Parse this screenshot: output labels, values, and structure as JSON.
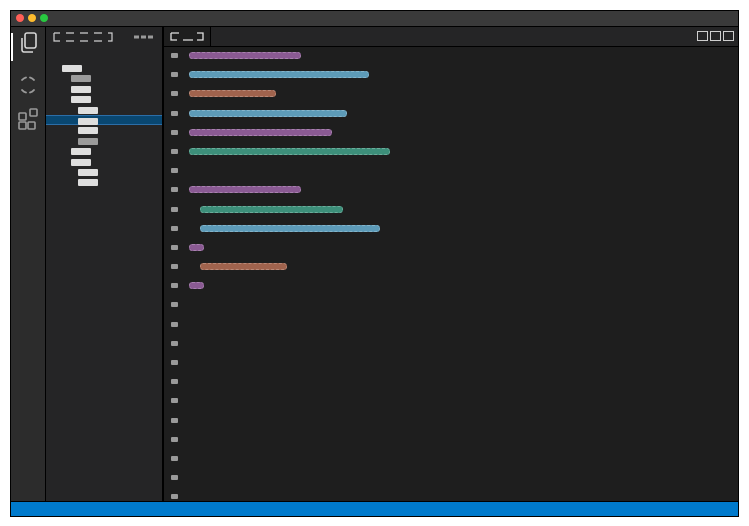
{
  "window": {
    "traffic_lights": [
      {
        "name": "close",
        "color": "#ff5f57"
      },
      {
        "name": "minimize",
        "color": "#febc2e"
      },
      {
        "name": "maximize",
        "color": "#28c840"
      }
    ]
  },
  "activity_bar": {
    "items": [
      {
        "name": "explorer-icon",
        "active": true
      },
      {
        "name": "source-control-icon",
        "active": false
      },
      {
        "name": "extensions-icon",
        "active": false
      }
    ]
  },
  "sidebar": {
    "header_title": "",
    "header_actions": "",
    "tree": [
      {
        "indent": 0,
        "width": 20,
        "dim": false,
        "selected": false
      },
      {
        "indent": 1,
        "width": 20,
        "dim": true,
        "selected": false
      },
      {
        "indent": 1,
        "width": 20,
        "dim": false,
        "selected": false
      },
      {
        "indent": 1,
        "width": 20,
        "dim": false,
        "selected": false
      },
      {
        "indent": 2,
        "width": 20,
        "dim": false,
        "selected": false
      },
      {
        "indent": 2,
        "width": 20,
        "dim": false,
        "selected": true
      },
      {
        "indent": 2,
        "width": 20,
        "dim": false,
        "selected": false
      },
      {
        "indent": 2,
        "width": 20,
        "dim": true,
        "selected": false
      },
      {
        "indent": 1,
        "width": 20,
        "dim": false,
        "selected": false
      },
      {
        "indent": 1,
        "width": 20,
        "dim": false,
        "selected": false
      },
      {
        "indent": 2,
        "width": 20,
        "dim": false,
        "selected": false
      },
      {
        "indent": 2,
        "width": 20,
        "dim": false,
        "selected": false
      }
    ]
  },
  "editor": {
    "tab_label": "",
    "colors": {
      "purple": "#8a5a93",
      "blue": "#5d9bb8",
      "brown": "#a0634d",
      "green": "#3d8f7a"
    },
    "lines": [
      {
        "indent": 0,
        "color": "purple",
        "length": 112
      },
      {
        "indent": 0,
        "color": "blue",
        "length": 180
      },
      {
        "indent": 0,
        "color": "brown",
        "length": 87
      },
      {
        "indent": 0,
        "color": "blue",
        "length": 158
      },
      {
        "indent": 0,
        "color": "purple",
        "length": 143
      },
      {
        "indent": 0,
        "color": "green",
        "length": 201
      },
      {
        "indent": 0,
        "color": "",
        "length": 0
      },
      {
        "indent": 0,
        "color": "purple",
        "length": 112
      },
      {
        "indent": 1,
        "color": "green",
        "length": 143
      },
      {
        "indent": 1,
        "color": "blue",
        "length": 180
      },
      {
        "indent": 0,
        "color": "purple",
        "length": 15
      },
      {
        "indent": 1,
        "color": "brown",
        "length": 87
      },
      {
        "indent": 0,
        "color": "purple",
        "length": 15
      },
      {
        "indent": 0,
        "color": "",
        "length": 0
      },
      {
        "indent": 0,
        "color": "",
        "length": 0
      },
      {
        "indent": 0,
        "color": "",
        "length": 0
      },
      {
        "indent": 0,
        "color": "",
        "length": 0
      },
      {
        "indent": 0,
        "color": "",
        "length": 0
      },
      {
        "indent": 0,
        "color": "",
        "length": 0
      },
      {
        "indent": 0,
        "color": "",
        "length": 0
      },
      {
        "indent": 0,
        "color": "",
        "length": 0
      },
      {
        "indent": 0,
        "color": "",
        "length": 0
      },
      {
        "indent": 0,
        "color": "",
        "length": 0
      },
      {
        "indent": 0,
        "color": "",
        "length": 0
      }
    ]
  },
  "status_bar": {
    "color": "#007acc",
    "text": ""
  }
}
